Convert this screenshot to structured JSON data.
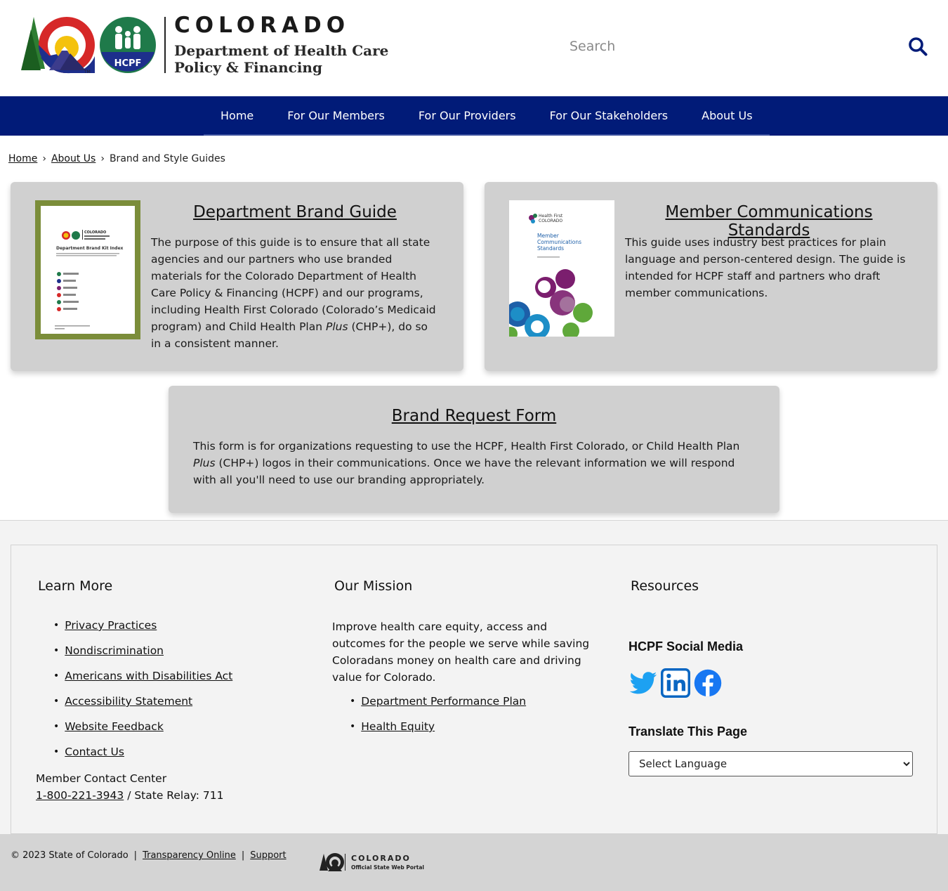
{
  "header": {
    "logo_colorado": "COLORADO",
    "logo_dept": "Department of Health Care Policy & Financing",
    "hcpf_badge": "HCPF",
    "search_placeholder": "Search"
  },
  "nav": {
    "items": [
      "Home",
      "For Our Members",
      "For Our Providers",
      "For Our Stakeholders",
      "About Us"
    ]
  },
  "breadcrumb": {
    "home": "Home",
    "about": "About Us",
    "current": "Brand and Style Guides"
  },
  "cards": {
    "brand_guide": {
      "title": "Department Brand Guide",
      "text_before": "The purpose of this guide is to ensure that all state agencies and our partners who use branded materials for the Colorado Department of Health Care Policy & Financing (HCPF) and our programs, including Health First Colorado (Colorado’s Medicaid program) and Child Health Plan ",
      "text_italic": "Plus",
      "text_after": " (CHP+), do so in a consistent manner.",
      "thumb_title": "Department Brand Kit Index"
    },
    "member_comms": {
      "title": "Member Communications Standards",
      "text": "This guide uses industry best practices for plain language and person-centered design. The guide is intended for HCPF staff and partners who draft member communications.",
      "thumb_title": "Member Communications Standards"
    },
    "request_form": {
      "title": "Brand Request Form",
      "text_before": "This form is for organizations requesting to use the HCPF, Health First Colorado, or Child Health Plan ",
      "text_italic": "Plus",
      "text_after": " (CHP+) logos in their communications. Once we have the relevant information we will respond with all you'll need to use our branding appropriately."
    }
  },
  "footer": {
    "learn_more": {
      "heading": "Learn More",
      "links": [
        "Privacy Practices",
        "Nondiscrimination",
        "Americans with Disabilities Act",
        "Accessibility Statement",
        "Website Feedback",
        "Contact Us"
      ]
    },
    "contact": {
      "label": "Member Contact Center",
      "phone": "1-800-221-3943",
      "relay": " / State Relay: 711"
    },
    "mission": {
      "heading": "Our Mission",
      "text": "Improve health care equity, access and outcomes for the people we serve while saving Coloradans money on health care and driving value for Colorado.",
      "links": [
        "Department Performance Plan",
        "Health Equity"
      ]
    },
    "resources": {
      "heading": "Resources",
      "social_heading": "HCPF Social Media",
      "social_icons": [
        "twitter-icon",
        "linkedin-icon",
        "facebook-icon"
      ],
      "translate_heading": "Translate This Page",
      "language_select": "Select Language"
    },
    "bottom": {
      "copyright": "© 2023 State of Colorado",
      "transparency": "Transparency Online",
      "support": "Support",
      "portal_title": "COLORADO",
      "portal_sub": "Official State Web Portal"
    }
  },
  "colors": {
    "nav_bg": "#011b78",
    "card_bg": "#d0d0d0",
    "footer_bg": "#f3f3f3",
    "bottom_bar": "#d4d4d4",
    "hcpf_green": "#1f7a4a",
    "twitter": "#1da1f2",
    "linkedin": "#0a66c2",
    "facebook": "#1877f2"
  }
}
